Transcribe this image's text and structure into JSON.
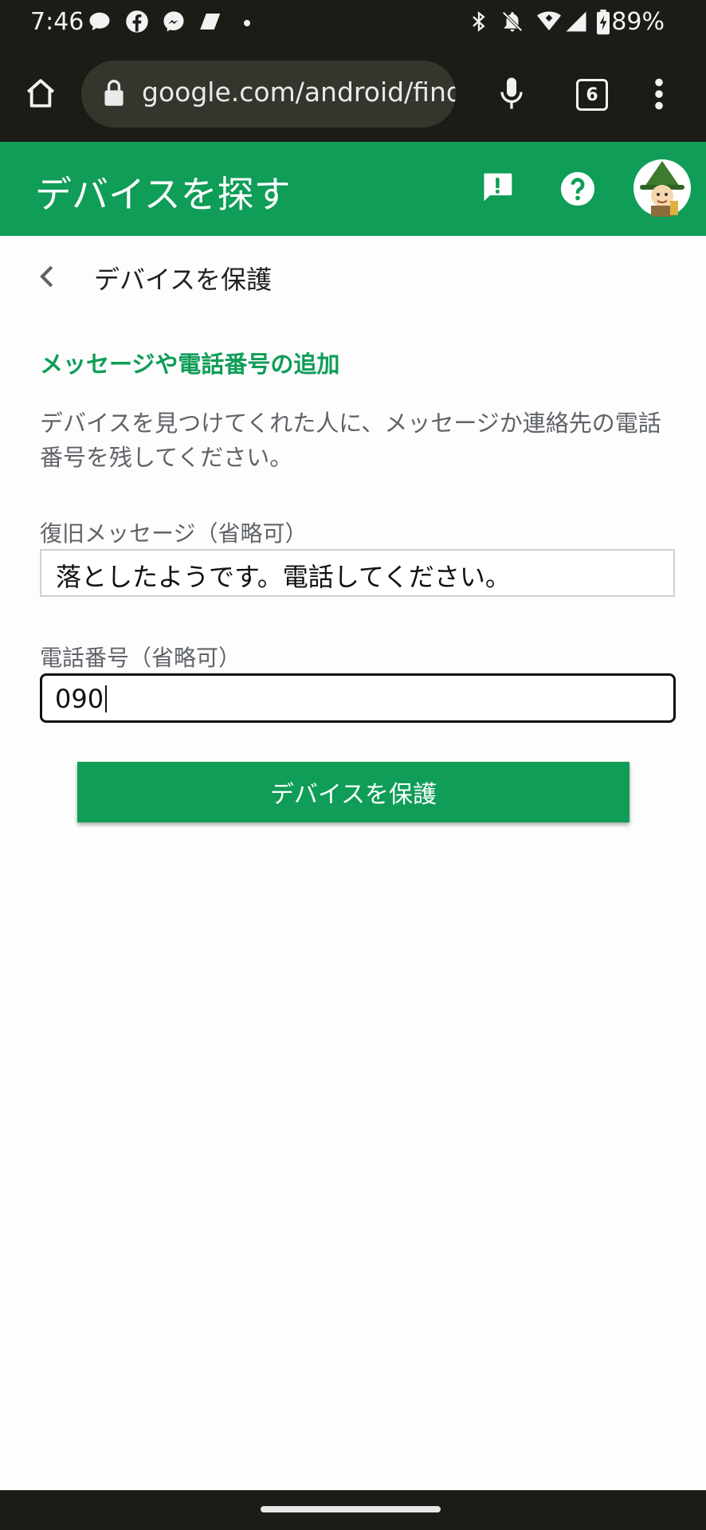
{
  "status_bar": {
    "time": "7:46",
    "battery": "89%",
    "icons": [
      "chat-bubble-icon",
      "facebook-icon",
      "messenger-icon",
      "app-icon",
      "dot-icon",
      "bluetooth-icon",
      "notifications-off-icon",
      "wifi-icon",
      "signal-icon",
      "battery-charging-icon"
    ]
  },
  "browser": {
    "url": "google.com/android/find/",
    "tab_count": "6",
    "icons": [
      "home-icon",
      "lock-icon",
      "mic-icon",
      "tabs-icon",
      "more-vert-icon"
    ]
  },
  "app_bar": {
    "title": "デバイスを探す",
    "icons": [
      "feedback-icon",
      "help-icon",
      "account-avatar"
    ]
  },
  "page": {
    "subtitle": "デバイスを保護",
    "section_title": "メッセージや電話番号の追加",
    "description": "デバイスを見つけてくれた人に、メッセージか連絡先の電話番号を残してください。",
    "recovery_message_label": "復旧メッセージ（省略可）",
    "recovery_message_value": "落としたようです。電話してください。",
    "phone_label": "電話番号（省略可）",
    "phone_value": "090",
    "submit_button": "デバイスを保護"
  },
  "colors": {
    "brand_green": "#0f9d58",
    "system_bar": "#1b1c16"
  }
}
